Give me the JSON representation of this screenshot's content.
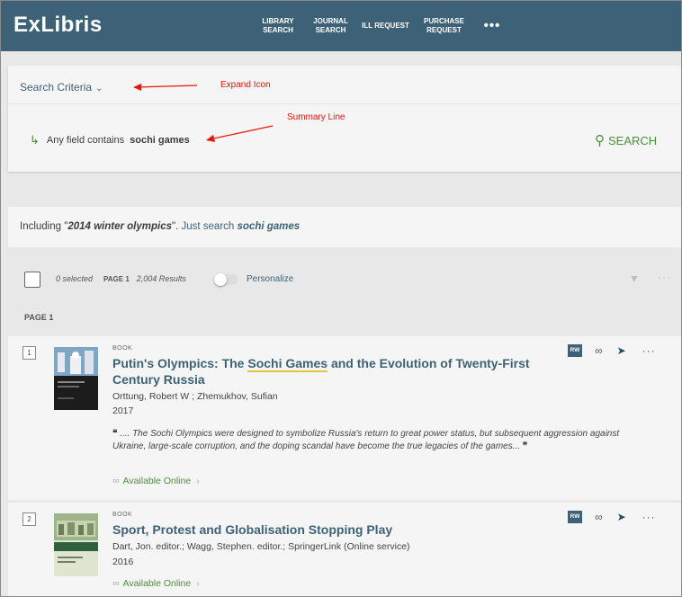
{
  "header": {
    "logo": "ExLibris",
    "nav": [
      {
        "label": "LIBRARY\nSEARCH",
        "width": 62
      },
      {
        "label": "JOURNAL\nSEARCH",
        "width": 55
      },
      {
        "label": "ILL REQUEST",
        "width": 67
      },
      {
        "label": "PURCHASE\nREQUEST",
        "width": 63
      }
    ],
    "more": "•••"
  },
  "criteria": {
    "title": "Search Criteria",
    "summary_prefix": "Any field contains",
    "summary_terms": "sochi games",
    "search_label": "SEARCH"
  },
  "annotations": {
    "expand": "Expand Icon",
    "summary": "Summary Line"
  },
  "including": {
    "prefix": "Including \"",
    "phrase": "2014 winter olympics",
    "suffix": "\".",
    "link_prefix": "Just search",
    "link_terms": "sochi games"
  },
  "results_bar": {
    "selected": "0 selected",
    "page": "PAGE 1",
    "count": "2,004 Results",
    "personalize": "Personalize"
  },
  "page_label": "PAGE 1",
  "results": [
    {
      "num": "1",
      "type": "BOOK",
      "title_before": "Putin's Olympics: The ",
      "title_highlight": "Sochi Games",
      "title_after": " and the Evolution of Twenty-First Century Russia",
      "authors": "Orttung, Robert W ; Zhemukhov, Sufian",
      "year": "2017",
      "snippet": ".... The Sochi Olympics were designed to symbolize Russia's return to great power status, but subsequent aggression against Ukraine, large-scale corruption, and the doping scandal have become the true legacies of the games...",
      "availability": "Available Online",
      "badge": "RW"
    },
    {
      "num": "2",
      "type": "BOOK",
      "title": "Sport, Protest and Globalisation Stopping Play",
      "authors": "Dart, Jon. editor.; Wagg, Stephen. editor.; SpringerLink (Online service)",
      "year": "2016",
      "availability": "Available Online",
      "badge": "RW"
    }
  ],
  "colors": {
    "header": "#3d6277",
    "link": "#3d6277",
    "available": "#4a8f3a",
    "annotation": "#e3170a",
    "highlight": "#e8c23b"
  }
}
